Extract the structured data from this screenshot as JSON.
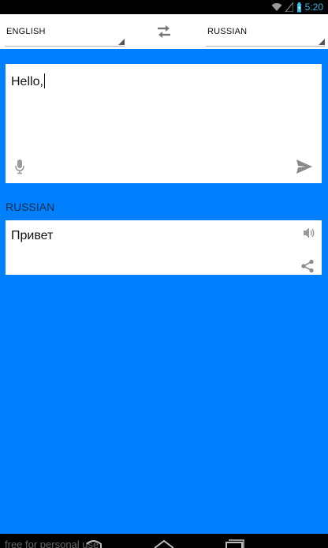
{
  "status_bar": {
    "time": "5:20",
    "wifi_icon": "wifi-icon",
    "signal_icon": "signal-icon",
    "battery_icon": "battery-icon",
    "accent_color": "#33b5e5"
  },
  "language_bar": {
    "source_language": "ENGLISH",
    "target_language": "RUSSIAN",
    "swap_icon": "swap-arrows-icon"
  },
  "input": {
    "text": "Hello,",
    "mic_icon": "microphone-icon",
    "send_icon": "send-icon"
  },
  "output": {
    "language_label": "RUSSIAN",
    "text": "Привет",
    "speaker_icon": "speaker-icon",
    "share_icon": "share-icon"
  },
  "nav_bar": {
    "watermark": "free for personal use",
    "back_icon": "back-icon",
    "home_icon": "home-icon",
    "recents_icon": "recents-icon"
  },
  "colors": {
    "background": "#0080ff",
    "card": "#ffffff"
  }
}
